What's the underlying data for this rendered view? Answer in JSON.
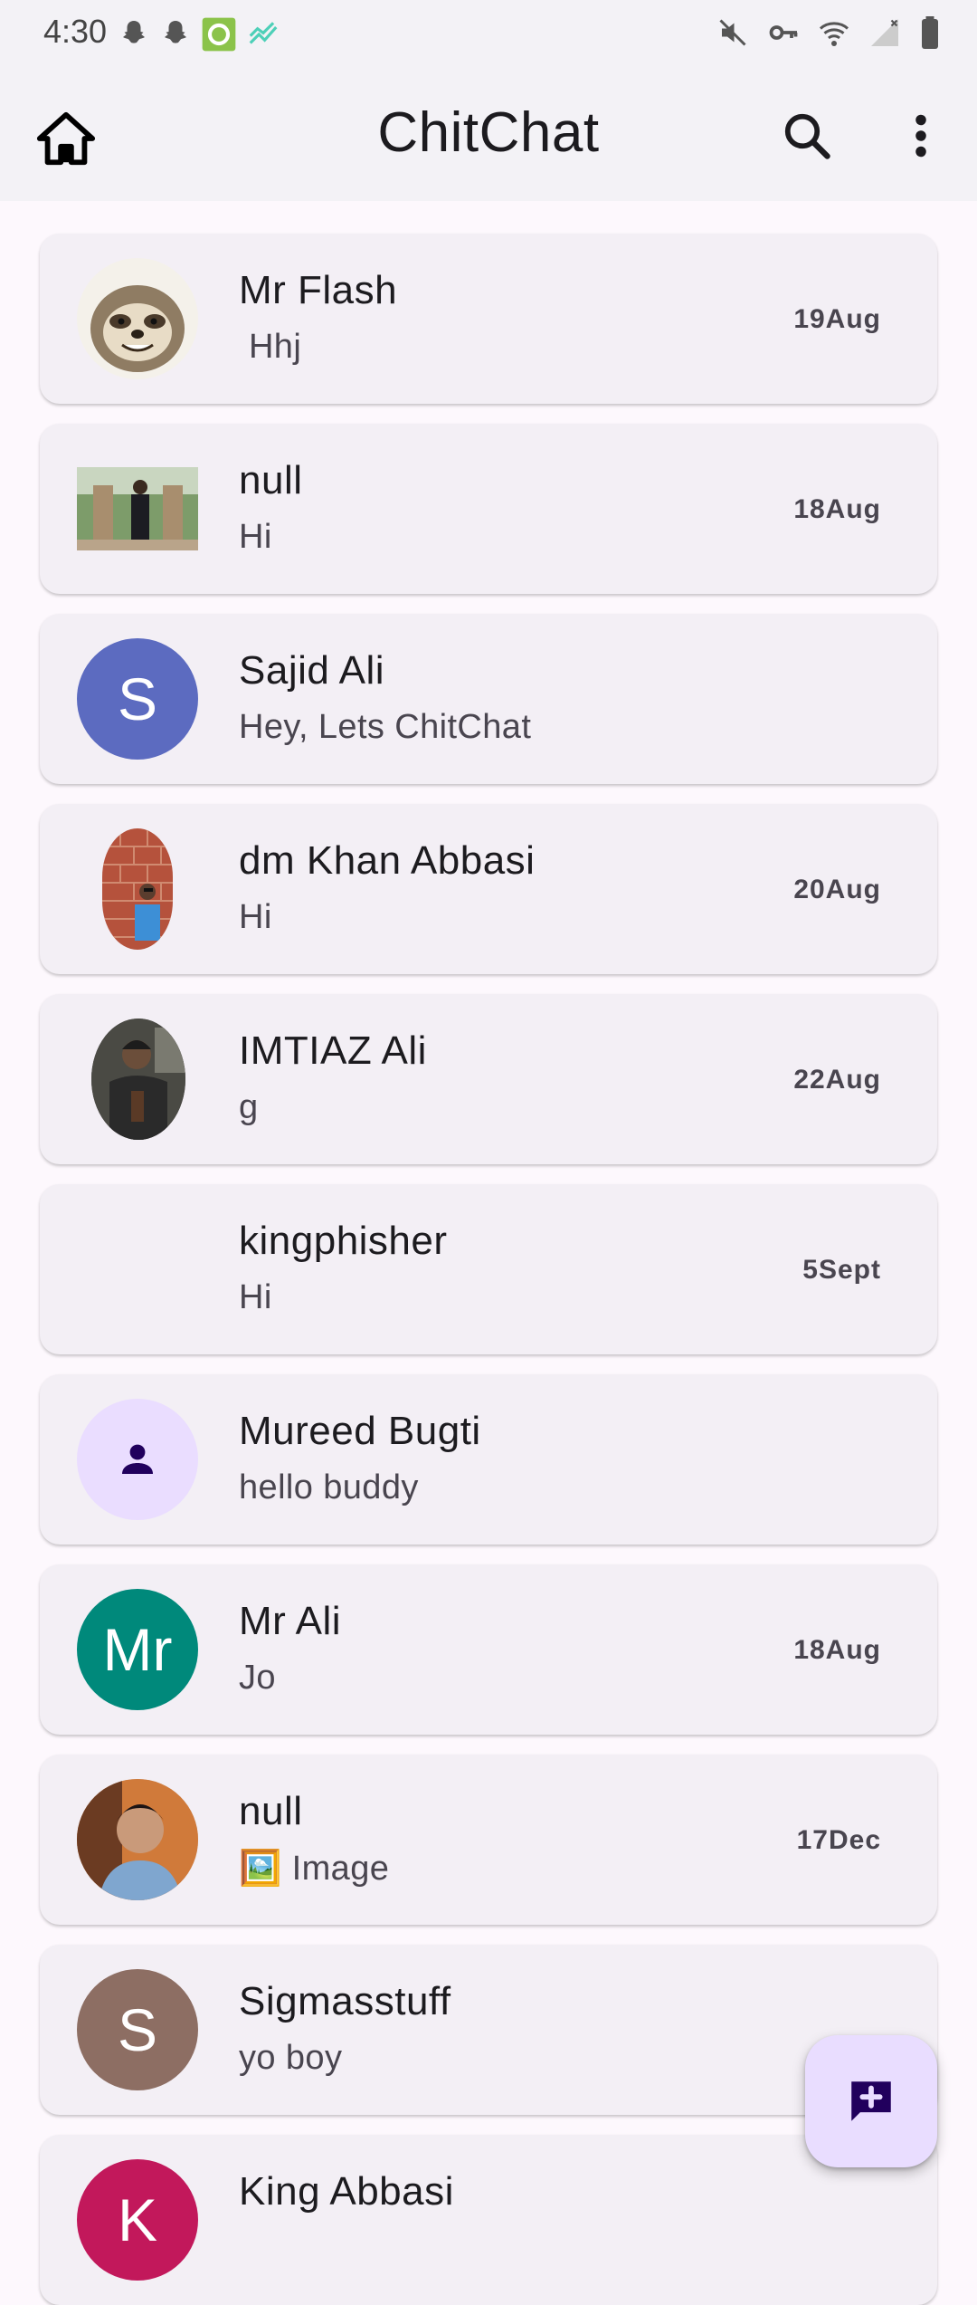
{
  "status_bar": {
    "time": "4:30",
    "left_icons": [
      "snapchat-icon",
      "snapchat-icon",
      "app-square-icon",
      "stocks-icon"
    ],
    "right_icons": [
      "mute-icon",
      "vpn-key-icon",
      "wifi-icon",
      "signal-icon",
      "battery-icon"
    ]
  },
  "app_bar": {
    "title": "ChitChat",
    "left_icon": "home-icon",
    "actions": [
      "search-icon",
      "more-vert-icon"
    ]
  },
  "chats": [
    {
      "name": "Mr Flash",
      "message": " Hhj",
      "date": "19Aug",
      "avatar": {
        "type": "photo",
        "desc": "sloth"
      }
    },
    {
      "name": "null",
      "message": "Hi",
      "date": "18Aug",
      "avatar": {
        "type": "photo",
        "desc": "person-garden"
      }
    },
    {
      "name": "Sajid Ali",
      "message": "Hey, Lets ChitChat",
      "date": "",
      "avatar": {
        "type": "letter",
        "letter": "S",
        "color": "#5c6bc0"
      }
    },
    {
      "name": "dm Khan Abbasi",
      "message": "Hi",
      "date": "20Aug",
      "avatar": {
        "type": "photo",
        "desc": "person-brick-wall"
      }
    },
    {
      "name": "IMTIAZ Ali",
      "message": "g",
      "date": "22Aug",
      "avatar": {
        "type": "photo",
        "desc": "person-dark"
      }
    },
    {
      "name": "kingphisher",
      "message": "Hi",
      "date": "5Sept",
      "avatar": {
        "type": "none"
      }
    },
    {
      "name": "Mureed Bugti",
      "message": "hello buddy",
      "date": "",
      "avatar": {
        "type": "icon",
        "icon": "person-icon",
        "color": "#eaddff"
      }
    },
    {
      "name": "Mr Ali",
      "message": "Jo",
      "date": "18Aug",
      "avatar": {
        "type": "letter",
        "letter": "Mr",
        "color": "#00897b"
      }
    },
    {
      "name": "null",
      "message": "🖼️ Image",
      "date": "17Dec",
      "avatar": {
        "type": "photo",
        "desc": "person-selfie"
      }
    },
    {
      "name": "Sigmasstuff",
      "message": "yo boy",
      "date": "",
      "avatar": {
        "type": "letter",
        "letter": "S",
        "color": "#8d6e63"
      }
    },
    {
      "name": "King Abbasi",
      "message": "",
      "date": "",
      "avatar": {
        "type": "letter",
        "letter": "K",
        "color": "#c2185b"
      }
    }
  ],
  "fab": {
    "icon": "add-comment-icon"
  },
  "colors": {
    "background": "#fdf8fd",
    "bar": "#f3f2f6",
    "card": "#f3eff5",
    "fab": "#e9ddff",
    "accent_dark": "#21005d"
  }
}
